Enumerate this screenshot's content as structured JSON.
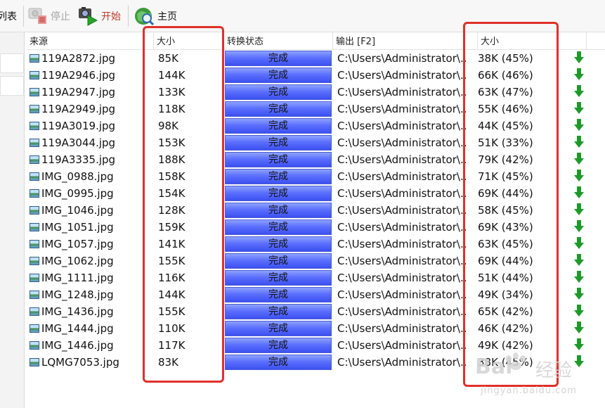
{
  "toolbar": {
    "left_cut_label": "列表",
    "stop_label": "停止",
    "start_label": "开始",
    "home_label": "主页",
    "stop_icon": "stop-icon",
    "start_icon": "start-icon",
    "home_icon": "home-globe-icon"
  },
  "columns": {
    "source": "来源",
    "size": "大小",
    "status": "转换状态",
    "output": "输出 [F2]",
    "out_size": "大小"
  },
  "colors": {
    "status_fill": "#4a5ef8",
    "highlight": "#e0302a",
    "arrow": "#1f9a2a"
  },
  "rows": [
    {
      "name": "119A2872.jpg",
      "size": "85K",
      "status": "完成",
      "output": "C:\\Users\\Administrator\\...",
      "out": "38K  (45%)"
    },
    {
      "name": "119A2946.jpg",
      "size": "144K",
      "status": "完成",
      "output": "C:\\Users\\Administrator\\...",
      "out": "66K  (46%)"
    },
    {
      "name": "119A2947.jpg",
      "size": "133K",
      "status": "完成",
      "output": "C:\\Users\\Administrator\\...",
      "out": "63K  (47%)"
    },
    {
      "name": "119A2949.jpg",
      "size": "118K",
      "status": "完成",
      "output": "C:\\Users\\Administrator\\...",
      "out": "55K  (46%)"
    },
    {
      "name": "119A3019.jpg",
      "size": "98K",
      "status": "完成",
      "output": "C:\\Users\\Administrator\\...",
      "out": "44K  (45%)"
    },
    {
      "name": "119A3044.jpg",
      "size": "153K",
      "status": "完成",
      "output": "C:\\Users\\Administrator\\...",
      "out": "51K  (33%)"
    },
    {
      "name": "119A3335.jpg",
      "size": "188K",
      "status": "完成",
      "output": "C:\\Users\\Administrator\\...",
      "out": "79K  (42%)"
    },
    {
      "name": "IMG_0988.jpg",
      "size": "158K",
      "status": "完成",
      "output": "C:\\Users\\Administrator\\...",
      "out": "71K  (45%)"
    },
    {
      "name": "IMG_0995.jpg",
      "size": "154K",
      "status": "完成",
      "output": "C:\\Users\\Administrator\\...",
      "out": "69K  (44%)"
    },
    {
      "name": "IMG_1046.jpg",
      "size": "128K",
      "status": "完成",
      "output": "C:\\Users\\Administrator\\...",
      "out": "58K  (45%)"
    },
    {
      "name": "IMG_1051.jpg",
      "size": "159K",
      "status": "完成",
      "output": "C:\\Users\\Administrator\\...",
      "out": "69K  (43%)"
    },
    {
      "name": "IMG_1057.jpg",
      "size": "141K",
      "status": "完成",
      "output": "C:\\Users\\Administrator\\...",
      "out": "63K  (45%)"
    },
    {
      "name": "IMG_1062.jpg",
      "size": "155K",
      "status": "完成",
      "output": "C:\\Users\\Administrator\\...",
      "out": "69K  (44%)"
    },
    {
      "name": "IMG_1111.jpg",
      "size": "116K",
      "status": "完成",
      "output": "C:\\Users\\Administrator\\...",
      "out": "51K  (44%)"
    },
    {
      "name": "IMG_1248.jpg",
      "size": "144K",
      "status": "完成",
      "output": "C:\\Users\\Administrator\\...",
      "out": "49K  (34%)"
    },
    {
      "name": "IMG_1436.jpg",
      "size": "155K",
      "status": "完成",
      "output": "C:\\Users\\Administrator\\...",
      "out": "65K  (42%)"
    },
    {
      "name": "IMG_1444.jpg",
      "size": "110K",
      "status": "完成",
      "output": "C:\\Users\\Administrator\\...",
      "out": "46K  (42%)"
    },
    {
      "name": "IMG_1446.jpg",
      "size": "117K",
      "status": "完成",
      "output": "C:\\Users\\Administrator\\...",
      "out": "49K  (42%)"
    },
    {
      "name": "LQMG7053.jpg",
      "size": "83K",
      "status": "完成",
      "output": "C:\\Users\\Administrator\\...",
      "out": "38K  (45%)"
    }
  ],
  "watermark": {
    "brand": "Bai",
    "brand2": "经验",
    "url": "jingyan.baidu.com"
  }
}
